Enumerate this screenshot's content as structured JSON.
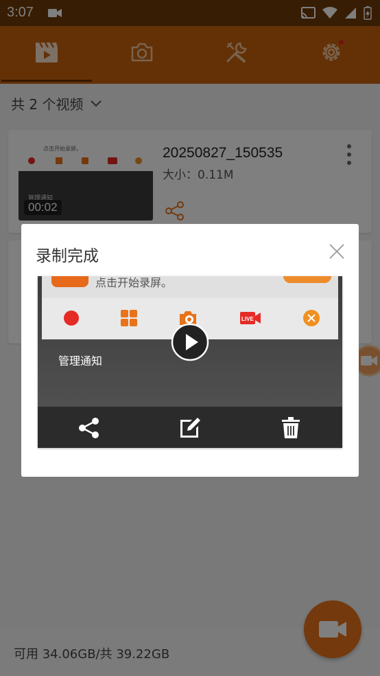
{
  "status_bar": {
    "time": "3:07"
  },
  "tabs": [
    {
      "id": "videos",
      "icon": "video-clapper-icon",
      "active": true
    },
    {
      "id": "screenshots",
      "icon": "camera-icon",
      "active": false
    },
    {
      "id": "tools",
      "icon": "tools-icon",
      "active": false
    },
    {
      "id": "settings",
      "icon": "gear-icon",
      "active": false
    }
  ],
  "list": {
    "count_label": "共 2 个视频",
    "items": [
      {
        "name": "20250827_150535",
        "size": "大小：0.11M",
        "duration": "00:02",
        "thumb_text": "点击开始录屏。",
        "thumb_notice": "管理通知"
      }
    ]
  },
  "storage": {
    "label": "可用 34.06GB/共 39.22GB"
  },
  "dialog": {
    "title": "录制完成",
    "preview_hint": "点击开始录屏。",
    "preview_manage": "管理通知",
    "live_label": "LIVE"
  },
  "colors": {
    "accent": "#e8731a",
    "tabbar": "#c8620e",
    "statusbar": "#6e3a06",
    "record_red": "#e52b25"
  }
}
